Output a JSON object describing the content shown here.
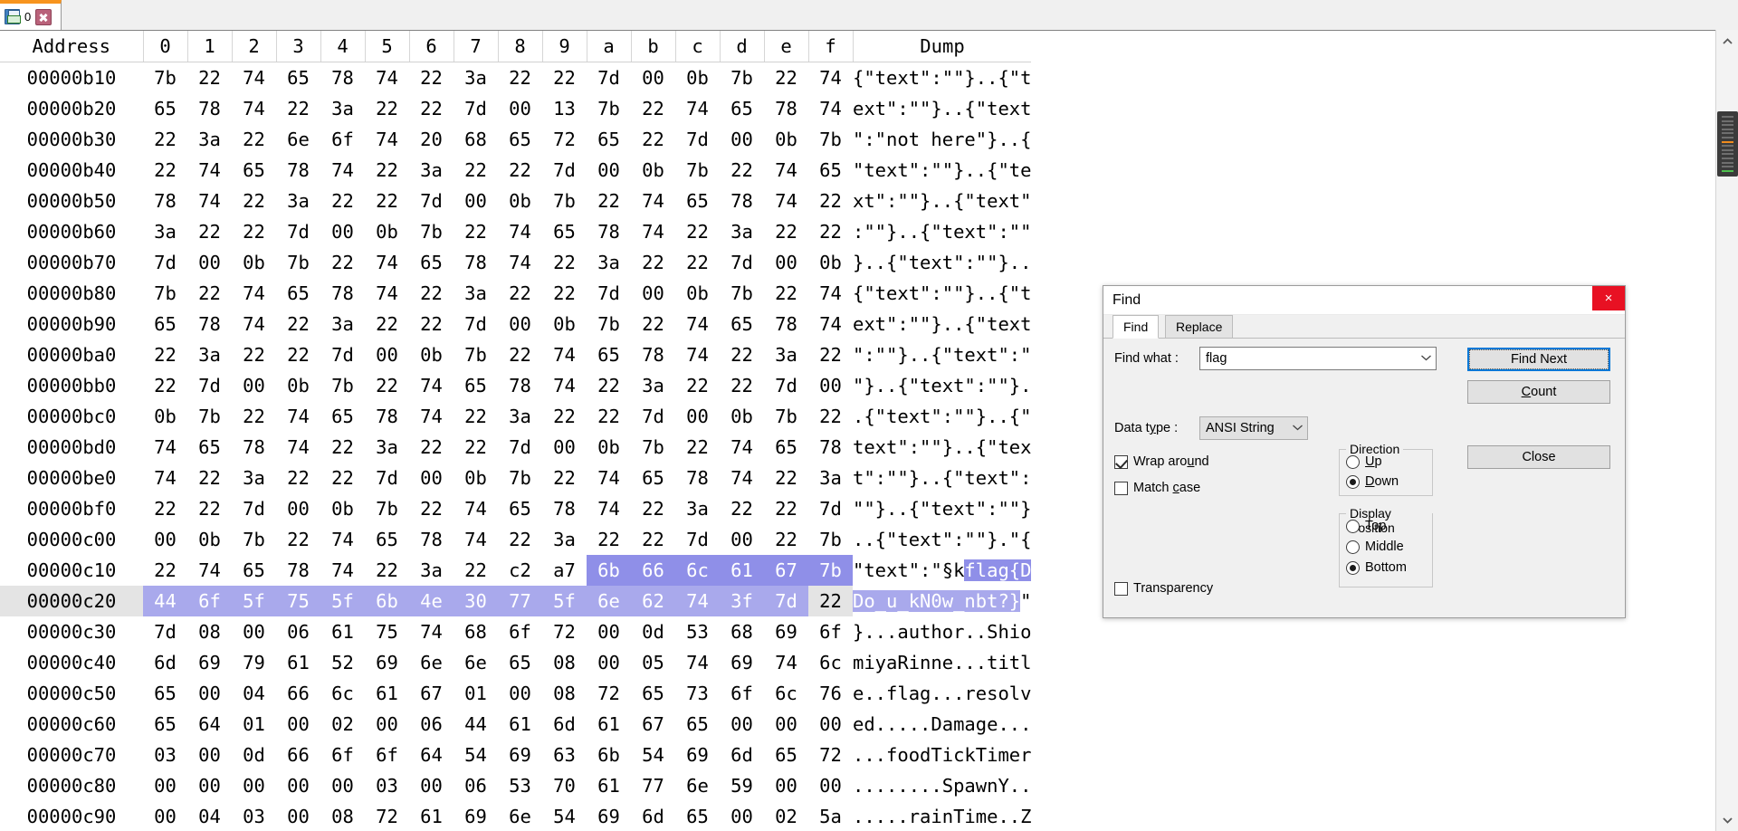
{
  "tabstrip": {
    "tabs": [
      {
        "label": "0",
        "icon": "floppy-disk-icon",
        "close_icon": "x"
      }
    ]
  },
  "hexview": {
    "columns": [
      "Address",
      "0",
      "1",
      "2",
      "3",
      "4",
      "5",
      "6",
      "7",
      "8",
      "9",
      "a",
      "b",
      "c",
      "d",
      "e",
      "f",
      "Dump"
    ],
    "highlight_color": "#8f8fe8",
    "row_highlight_color": "#a9a9ec",
    "rows": [
      {
        "address": "00000b10",
        "bytes": [
          "7b",
          "22",
          "74",
          "65",
          "78",
          "74",
          "22",
          "3a",
          "22",
          "22",
          "7d",
          "00",
          "0b",
          "7b",
          "22",
          "74"
        ],
        "dump": "{\"text\":\"\"}..{\"t",
        "hl": []
      },
      {
        "address": "00000b20",
        "bytes": [
          "65",
          "78",
          "74",
          "22",
          "3a",
          "22",
          "22",
          "7d",
          "00",
          "13",
          "7b",
          "22",
          "74",
          "65",
          "78",
          "74"
        ],
        "dump": "ext\":\"\"}..{\"text",
        "hl": []
      },
      {
        "address": "00000b30",
        "bytes": [
          "22",
          "3a",
          "22",
          "6e",
          "6f",
          "74",
          "20",
          "68",
          "65",
          "72",
          "65",
          "22",
          "7d",
          "00",
          "0b",
          "7b"
        ],
        "dump": "\":\"not here\"}..{",
        "hl": []
      },
      {
        "address": "00000b40",
        "bytes": [
          "22",
          "74",
          "65",
          "78",
          "74",
          "22",
          "3a",
          "22",
          "22",
          "7d",
          "00",
          "0b",
          "7b",
          "22",
          "74",
          "65"
        ],
        "dump": "\"text\":\"\"}..{\"te",
        "hl": []
      },
      {
        "address": "00000b50",
        "bytes": [
          "78",
          "74",
          "22",
          "3a",
          "22",
          "22",
          "7d",
          "00",
          "0b",
          "7b",
          "22",
          "74",
          "65",
          "78",
          "74",
          "22"
        ],
        "dump": "xt\":\"\"}..{\"text\"",
        "hl": []
      },
      {
        "address": "00000b60",
        "bytes": [
          "3a",
          "22",
          "22",
          "7d",
          "00",
          "0b",
          "7b",
          "22",
          "74",
          "65",
          "78",
          "74",
          "22",
          "3a",
          "22",
          "22"
        ],
        "dump": ":\"\"}..{\"text\":\"\"",
        "hl": []
      },
      {
        "address": "00000b70",
        "bytes": [
          "7d",
          "00",
          "0b",
          "7b",
          "22",
          "74",
          "65",
          "78",
          "74",
          "22",
          "3a",
          "22",
          "22",
          "7d",
          "00",
          "0b"
        ],
        "dump": "}..{\"text\":\"\"}..",
        "hl": []
      },
      {
        "address": "00000b80",
        "bytes": [
          "7b",
          "22",
          "74",
          "65",
          "78",
          "74",
          "22",
          "3a",
          "22",
          "22",
          "7d",
          "00",
          "0b",
          "7b",
          "22",
          "74"
        ],
        "dump": "{\"text\":\"\"}..{\"t",
        "hl": []
      },
      {
        "address": "00000b90",
        "bytes": [
          "65",
          "78",
          "74",
          "22",
          "3a",
          "22",
          "22",
          "7d",
          "00",
          "0b",
          "7b",
          "22",
          "74",
          "65",
          "78",
          "74"
        ],
        "dump": "ext\":\"\"}..{\"text",
        "hl": []
      },
      {
        "address": "00000ba0",
        "bytes": [
          "22",
          "3a",
          "22",
          "22",
          "7d",
          "00",
          "0b",
          "7b",
          "22",
          "74",
          "65",
          "78",
          "74",
          "22",
          "3a",
          "22"
        ],
        "dump": "\":\"\"}..{\"text\":\"",
        "hl": []
      },
      {
        "address": "00000bb0",
        "bytes": [
          "22",
          "7d",
          "00",
          "0b",
          "7b",
          "22",
          "74",
          "65",
          "78",
          "74",
          "22",
          "3a",
          "22",
          "22",
          "7d",
          "00"
        ],
        "dump": "\"}..{\"text\":\"\"}.",
        "hl": []
      },
      {
        "address": "00000bc0",
        "bytes": [
          "0b",
          "7b",
          "22",
          "74",
          "65",
          "78",
          "74",
          "22",
          "3a",
          "22",
          "22",
          "7d",
          "00",
          "0b",
          "7b",
          "22"
        ],
        "dump": ".{\"text\":\"\"}..{\"",
        "hl": []
      },
      {
        "address": "00000bd0",
        "bytes": [
          "74",
          "65",
          "78",
          "74",
          "22",
          "3a",
          "22",
          "22",
          "7d",
          "00",
          "0b",
          "7b",
          "22",
          "74",
          "65",
          "78"
        ],
        "dump": "text\":\"\"}..{\"tex",
        "hl": []
      },
      {
        "address": "00000be0",
        "bytes": [
          "74",
          "22",
          "3a",
          "22",
          "22",
          "7d",
          "00",
          "0b",
          "7b",
          "22",
          "74",
          "65",
          "78",
          "74",
          "22",
          "3a"
        ],
        "dump": "t\":\"\"}..{\"text\":",
        "hl": []
      },
      {
        "address": "00000bf0",
        "bytes": [
          "22",
          "22",
          "7d",
          "00",
          "0b",
          "7b",
          "22",
          "74",
          "65",
          "78",
          "74",
          "22",
          "3a",
          "22",
          "22",
          "7d"
        ],
        "dump": "\"\"}..{\"text\":\"\"}",
        "hl": []
      },
      {
        "address": "00000c00",
        "bytes": [
          "00",
          "0b",
          "7b",
          "22",
          "74",
          "65",
          "78",
          "74",
          "22",
          "3a",
          "22",
          "22",
          "7d",
          "00",
          "22",
          "7b"
        ],
        "dump": "..{\"text\":\"\"}.\"{",
        "hl": []
      },
      {
        "address": "00000c10",
        "bytes": [
          "22",
          "74",
          "65",
          "78",
          "74",
          "22",
          "3a",
          "22",
          "c2",
          "a7",
          "6b",
          "66",
          "6c",
          "61",
          "67",
          "7b"
        ],
        "dump_plain": "\"text\":\"§k",
        "dump_hl": "flag{D",
        "hl": [
          10,
          11,
          12,
          13,
          14,
          15
        ]
      },
      {
        "address": "00000c20",
        "bytes": [
          "44",
          "6f",
          "5f",
          "75",
          "5f",
          "6b",
          "4e",
          "30",
          "77",
          "5f",
          "6e",
          "62",
          "74",
          "3f",
          "7d",
          "22"
        ],
        "dump_hl": "Do_u_kN0w_nbt?}",
        "dump_tail": "\"",
        "rowhl": true,
        "gap": [
          15
        ]
      },
      {
        "address": "00000c30",
        "bytes": [
          "7d",
          "08",
          "00",
          "06",
          "61",
          "75",
          "74",
          "68",
          "6f",
          "72",
          "00",
          "0d",
          "53",
          "68",
          "69",
          "6f"
        ],
        "dump": "}...author..Shio",
        "hl": []
      },
      {
        "address": "00000c40",
        "bytes": [
          "6d",
          "69",
          "79",
          "61",
          "52",
          "69",
          "6e",
          "6e",
          "65",
          "08",
          "00",
          "05",
          "74",
          "69",
          "74",
          "6c"
        ],
        "dump": "miyaRinne...titl",
        "hl": []
      },
      {
        "address": "00000c50",
        "bytes": [
          "65",
          "00",
          "04",
          "66",
          "6c",
          "61",
          "67",
          "01",
          "00",
          "08",
          "72",
          "65",
          "73",
          "6f",
          "6c",
          "76"
        ],
        "dump": "e..flag...resolv",
        "hl": []
      },
      {
        "address": "00000c60",
        "bytes": [
          "65",
          "64",
          "01",
          "00",
          "02",
          "00",
          "06",
          "44",
          "61",
          "6d",
          "61",
          "67",
          "65",
          "00",
          "00",
          "00"
        ],
        "dump": "ed.....Damage...",
        "hl": []
      },
      {
        "address": "00000c70",
        "bytes": [
          "03",
          "00",
          "0d",
          "66",
          "6f",
          "6f",
          "64",
          "54",
          "69",
          "63",
          "6b",
          "54",
          "69",
          "6d",
          "65",
          "72"
        ],
        "dump": "...foodTickTimer",
        "hl": []
      },
      {
        "address": "00000c80",
        "bytes": [
          "00",
          "00",
          "00",
          "00",
          "00",
          "03",
          "00",
          "06",
          "53",
          "70",
          "61",
          "77",
          "6e",
          "59",
          "00",
          "00"
        ],
        "dump": "........SpawnY..",
        "hl": []
      },
      {
        "address": "00000c90",
        "bytes": [
          "00",
          "04",
          "03",
          "00",
          "08",
          "72",
          "61",
          "69",
          "6e",
          "54",
          "69",
          "6d",
          "65",
          "00",
          "02",
          "5a"
        ],
        "dump": ".....rainTime..Z",
        "hl": []
      }
    ]
  },
  "scrollbar": {
    "up_icon": "chevron-up-icon",
    "down_icon": "chevron-down-icon",
    "mark_orange": "#f08c1e",
    "mark_green": "#4fc04f"
  },
  "find_dialog": {
    "title": "Find",
    "close_label": "×",
    "tabs": [
      {
        "label": "Find",
        "selected": true
      },
      {
        "label": "Replace",
        "selected": false
      }
    ],
    "find_what_label": "Find what :",
    "find_what_value": "flag",
    "find_what_chevron": "⌄",
    "data_type_label": "Data type :",
    "data_type_value": "ANSI String",
    "data_type_chevron": "⌄",
    "checkboxes": [
      {
        "label": "Wrap around",
        "checked": true
      },
      {
        "label": "Match case",
        "checked": false
      },
      {
        "label": "Transparency",
        "checked": false
      }
    ],
    "direction": {
      "legend": "Direction",
      "options": [
        {
          "label": "Up",
          "selected": false
        },
        {
          "label": "Down",
          "selected": true
        }
      ]
    },
    "display_position": {
      "legend": "Display Position",
      "options": [
        {
          "label": "Top",
          "selected": false
        },
        {
          "label": "Middle",
          "selected": false
        },
        {
          "label": "Bottom",
          "selected": true
        }
      ]
    },
    "buttons": [
      {
        "label": "Find Next",
        "focused": true
      },
      {
        "label": "Count",
        "focused": false
      },
      {
        "label": "Close",
        "focused": false
      }
    ],
    "accent_focus_color": "#0078d7",
    "close_color": "#e81123"
  }
}
